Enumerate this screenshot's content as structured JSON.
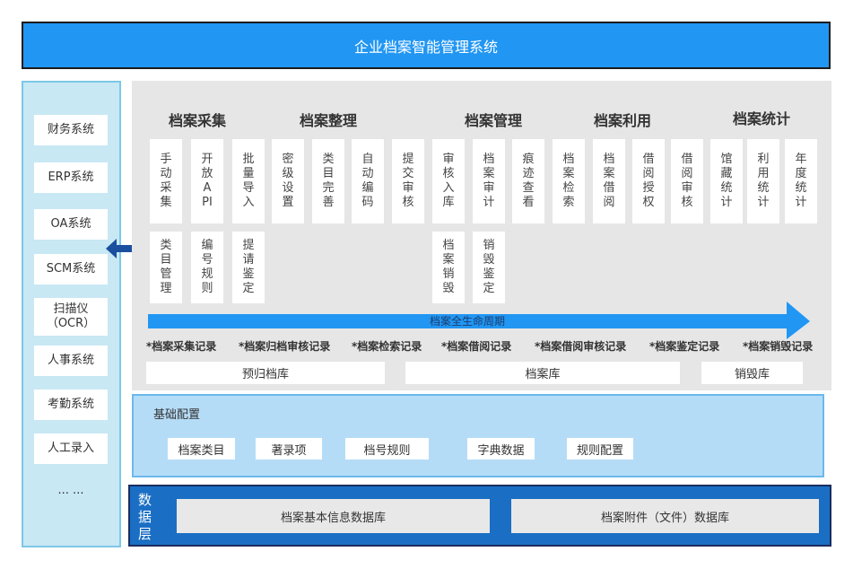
{
  "title": "企业档案智能管理系统",
  "left_systems": [
    "财务系统",
    "ERP系统",
    "OA系统",
    "SCM系统",
    "扫描仪\n（OCR）",
    "人事系统",
    "考勤系统",
    "人工录入"
  ],
  "left_more": "... ...",
  "categories": [
    "档案采集",
    "档案整理",
    "档案管理",
    "档案利用",
    "档案统计"
  ],
  "functions_row1": [
    "手动采集",
    "开放API",
    "批量导入",
    "密级设置",
    "类目完善",
    "自动编码",
    "提交审核",
    "审核入库",
    "档案审计",
    "痕迹查看",
    "档案检索",
    "档案借阅",
    "借阅授权",
    "借阅审核",
    "馆藏统计",
    "利用统计",
    "年度统计"
  ],
  "functions_row2": [
    "类目管理",
    "编号规则",
    "提请鉴定",
    "档案销毁",
    "销毁鉴定"
  ],
  "lifecycle_label": "档案全生命周期",
  "records": [
    "*档案采集记录",
    "*档案归档审核记录",
    "*档案检索记录",
    "*档案借阅记录",
    "*档案借阅审核记录",
    "*档案鉴定记录",
    "*档案销毁记录"
  ],
  "stores": [
    "预归档库",
    "档案库",
    "销毁库"
  ],
  "base_config": {
    "title": "基础配置",
    "items": [
      "档案类目",
      "著录项",
      "档号规则",
      "字典数据",
      "规则配置"
    ]
  },
  "data_layer": {
    "label": "数据层",
    "items": [
      "档案基本信息数据库",
      "档案附件（文件）数据库"
    ]
  },
  "colors": {
    "title_bar": "#2196f3",
    "arrow": "#2196f3",
    "double_arrow": "#1a4fa0",
    "data_layer": "#1a6fc4"
  }
}
